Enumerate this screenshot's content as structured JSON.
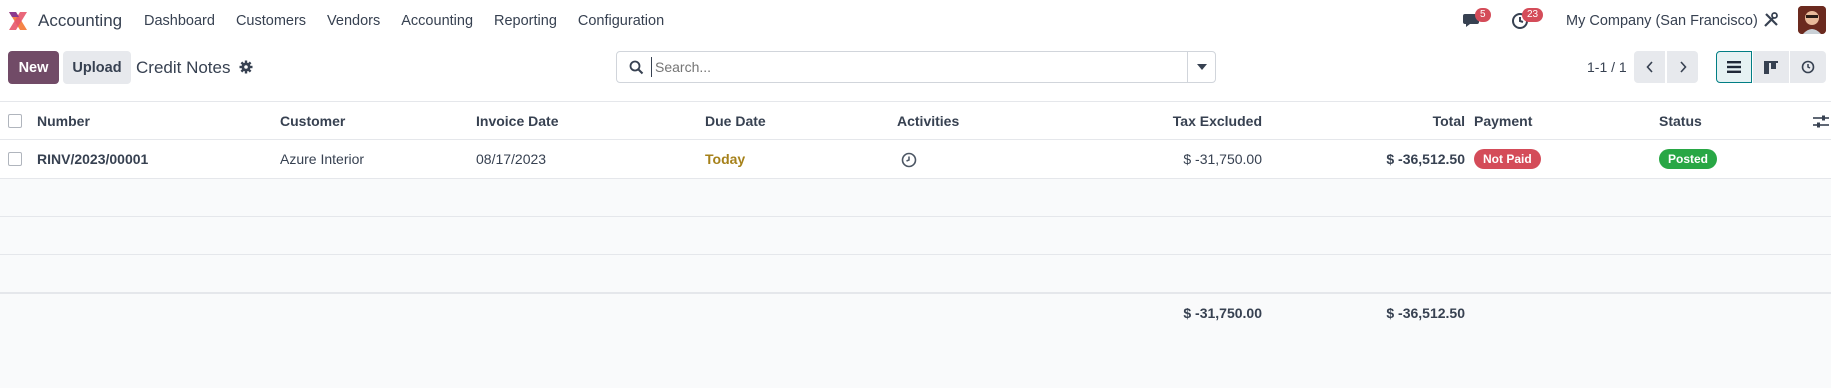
{
  "navbar": {
    "app_name": "Accounting",
    "menu": [
      "Dashboard",
      "Customers",
      "Vendors",
      "Accounting",
      "Reporting",
      "Configuration"
    ],
    "messages_count": "5",
    "activities_count": "23",
    "company": "My Company (San Francisco)"
  },
  "control": {
    "new_label": "New",
    "upload_label": "Upload",
    "title": "Credit Notes",
    "search_placeholder": "Search...",
    "pager": "1-1 / 1"
  },
  "table": {
    "columns": {
      "number": "Number",
      "customer": "Customer",
      "invoice_date": "Invoice Date",
      "due_date": "Due Date",
      "activities": "Activities",
      "tax_excluded": "Tax Excluded",
      "total": "Total",
      "payment": "Payment",
      "status": "Status"
    },
    "rows": [
      {
        "number": "RINV/2023/00001",
        "customer": "Azure Interior",
        "invoice_date": "08/17/2023",
        "due_date": "Today",
        "tax_excluded": "$ -31,750.00",
        "total": "$ -36,512.50",
        "payment": "Not Paid",
        "status": "Posted"
      }
    ],
    "totals": {
      "tax_excluded": "$ -31,750.00",
      "total": "$ -36,512.50"
    }
  },
  "colors": {
    "primary": "#714b67",
    "not_paid": "#d44c59",
    "posted": "#28a745",
    "today": "#a6811a"
  }
}
